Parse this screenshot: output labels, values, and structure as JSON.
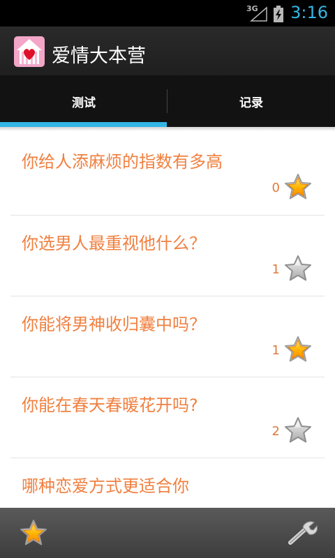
{
  "status_bar": {
    "network": "3G",
    "time": "3:16",
    "icons": [
      "signal-icon",
      "battery-charging-icon"
    ]
  },
  "action_bar": {
    "title": "爱情大本营",
    "icon": "house-heart-app-icon"
  },
  "tabs": [
    {
      "label": "测试",
      "selected": true
    },
    {
      "label": "记录",
      "selected": false
    }
  ],
  "accent_color": "#33b5e5",
  "item_title_color": "#f08040",
  "items": [
    {
      "title": "你给人添麻烦的指数有多高",
      "count": "0",
      "favorite": true
    },
    {
      "title": "你选男人最重视他什么？",
      "count": "1",
      "favorite": false
    },
    {
      "title": "你能将男神收归囊中吗？",
      "count": "1",
      "favorite": true
    },
    {
      "title": "你能在春天春暖花开吗?",
      "count": "2",
      "favorite": false
    },
    {
      "title": "哪种恋爱方式更适合你",
      "count": "",
      "favorite": false
    }
  ],
  "bottom_bar": {
    "left_icon": "favorite-star-icon",
    "right_icon": "wrench-settings-icon"
  }
}
